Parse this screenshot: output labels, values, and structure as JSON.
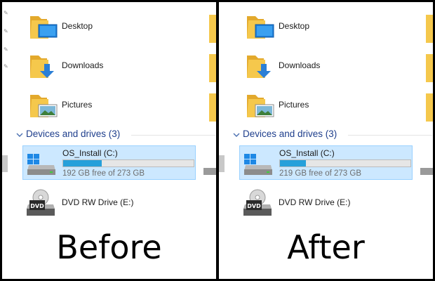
{
  "panels": [
    {
      "caption": "Before",
      "folders": [
        {
          "label": "Desktop",
          "icon": "desktop-folder-icon"
        },
        {
          "label": "Downloads",
          "icon": "downloads-folder-icon"
        },
        {
          "label": "Pictures",
          "icon": "pictures-folder-icon"
        }
      ],
      "section_header": "Devices and drives (3)",
      "drive_c": {
        "name": "OS_Install (C:)",
        "free_text": "192 GB free of 273 GB",
        "used_fraction": 0.297
      },
      "drive_e": {
        "name": "DVD RW Drive (E:)"
      }
    },
    {
      "caption": "After",
      "folders": [
        {
          "label": "Desktop",
          "icon": "desktop-folder-icon"
        },
        {
          "label": "Downloads",
          "icon": "downloads-folder-icon"
        },
        {
          "label": "Pictures",
          "icon": "pictures-folder-icon"
        }
      ],
      "section_header": "Devices and drives (3)",
      "drive_c": {
        "name": "OS_Install (C:)",
        "free_text": "219 GB free of 273 GB",
        "used_fraction": 0.198
      },
      "drive_e": {
        "name": "DVD RW Drive (E:)"
      }
    }
  ],
  "colors": {
    "selection_bg": "#cce8ff",
    "selection_border": "#99d1ff",
    "progress_fill": "#26a0da",
    "section_header": "#1e3e8c",
    "folder_yellow": "#f5c84c"
  }
}
